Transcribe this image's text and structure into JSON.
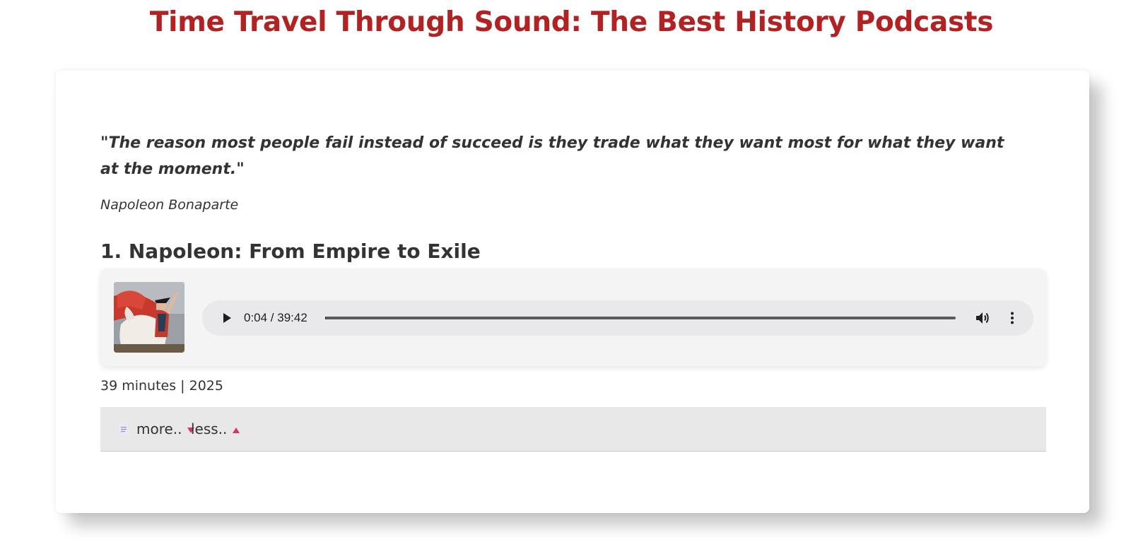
{
  "page": {
    "title": "Time Travel Through Sound: The Best History Podcasts"
  },
  "quote": {
    "text": "\"The reason most people fail instead of succeed is they trade what they want most for what they want at the moment.\"",
    "author": "Napoleon Bonaparte"
  },
  "episode": {
    "title": "1. Napoleon: From Empire to Exile",
    "cover_icon": "napoleon-crossing-alps-painting",
    "meta": "39 minutes | 2025"
  },
  "player": {
    "time_display": "0:04 / 39:42",
    "current_seconds": 4,
    "duration_seconds": 2382,
    "play_icon": "play-icon",
    "volume_icon": "volume-icon",
    "menu_icon": "more-vert-icon"
  },
  "details": {
    "doc_icon": "document-icon",
    "more_label": "more..",
    "less_label": "less.."
  },
  "colors": {
    "title": "#b22222",
    "accent_arrow": "#d6336c",
    "player_bg": "#f4f4f4",
    "details_bg": "#e8e8e8"
  }
}
